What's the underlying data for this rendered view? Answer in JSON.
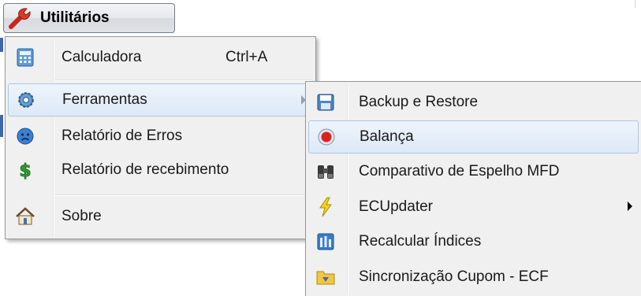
{
  "menubar": {
    "label": "Utilitários",
    "icon": "wrench-icon"
  },
  "menu": {
    "items": [
      {
        "label": "Calculadora",
        "shortcut": "Ctrl+A",
        "icon": "calculator-icon"
      },
      {
        "label": "Ferramentas",
        "icon": "gear-icon",
        "submenu": true
      },
      {
        "label": "Relatório de Erros",
        "icon": "sad-face-icon"
      },
      {
        "label": "Relatório de recebimento",
        "icon": "dollar-icon"
      },
      {
        "label": "Sobre",
        "icon": "home-icon"
      }
    ]
  },
  "submenu": {
    "items": [
      {
        "label": "Backup e Restore",
        "icon": "floppy-disk-icon"
      },
      {
        "label": "Balança",
        "icon": "red-dot-icon"
      },
      {
        "label": "Comparativo de Espelho MFD",
        "icon": "binoculars-icon"
      },
      {
        "label": "ECUpdater",
        "icon": "lightning-icon",
        "submenu": true
      },
      {
        "label": "Recalcular Índices",
        "icon": "recalc-icon"
      },
      {
        "label": "Sincronização Cupom - ECF",
        "icon": "folder-sync-icon"
      }
    ]
  },
  "colors": {
    "highlight": "#dde9f7",
    "highlight_border": "#a9c6e8",
    "menu_bg": "#f0f0f0"
  }
}
